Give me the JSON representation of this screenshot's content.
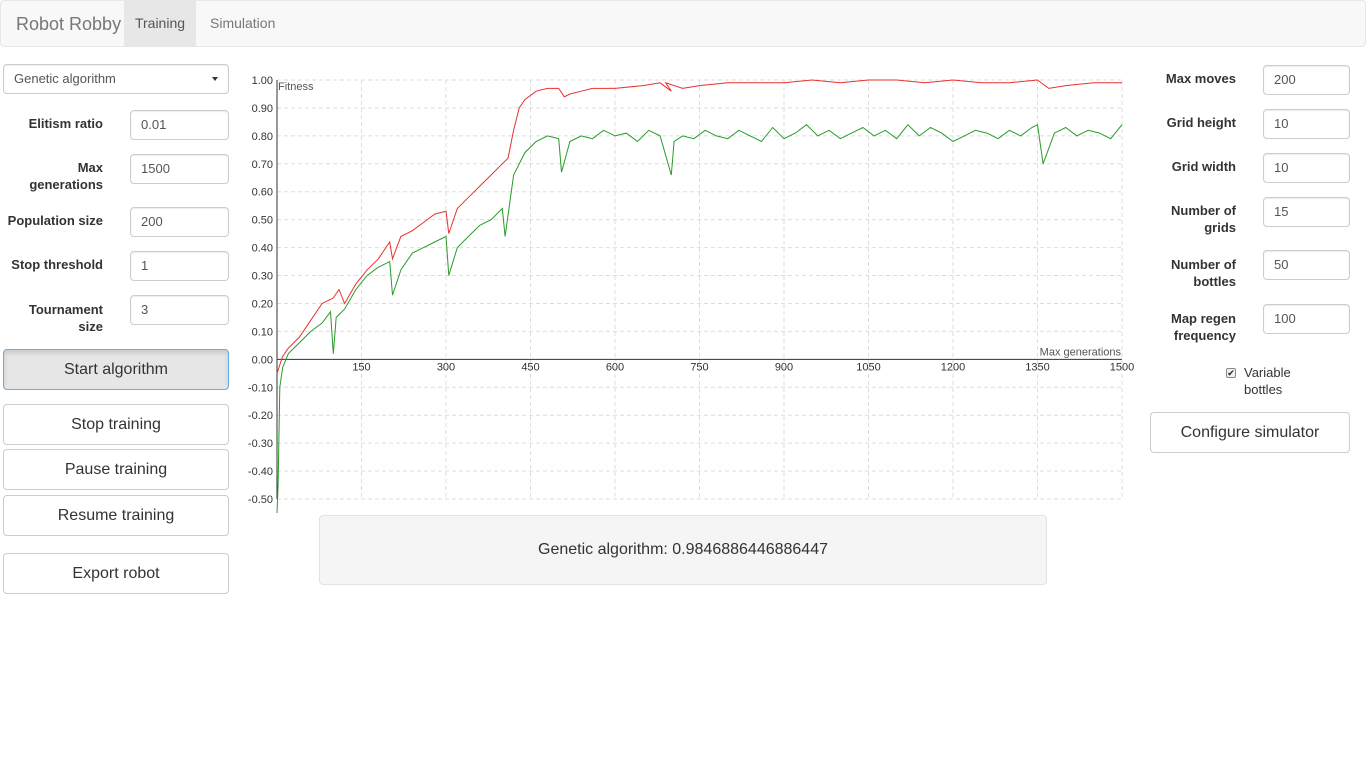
{
  "app": {
    "title": "Robot Robby"
  },
  "nav": {
    "tabs": [
      {
        "label": "Training",
        "active": true
      },
      {
        "label": "Simulation",
        "active": false
      }
    ]
  },
  "left_panel": {
    "algorithm_select": {
      "value": "Genetic algorithm"
    },
    "fields": [
      {
        "label": "Elitism ratio",
        "value": "0.01"
      },
      {
        "label": "Max generations",
        "value": "1500"
      },
      {
        "label": "Population size",
        "value": "200"
      },
      {
        "label": "Stop threshold",
        "value": "1"
      },
      {
        "label": "Tournament size",
        "value": "3"
      }
    ],
    "buttons": {
      "start": "Start algorithm",
      "stop": "Stop training",
      "pause": "Pause training",
      "resume": "Resume training",
      "export": "Export robot"
    }
  },
  "right_panel": {
    "fields": [
      {
        "label": "Max moves",
        "value": "200"
      },
      {
        "label": "Grid height",
        "value": "10"
      },
      {
        "label": "Grid width",
        "value": "10"
      },
      {
        "label": "Number of grids",
        "value": "15"
      },
      {
        "label": "Number of bottles",
        "value": "50"
      },
      {
        "label": "Map regen frequency",
        "value": "100"
      }
    ],
    "variable_bottles": {
      "label": "Variable bottles",
      "checked": true,
      "check_glyph": "✔"
    },
    "configure_button": "Configure simulator"
  },
  "result": {
    "text": "Genetic algorithm: 0.9846886446886447"
  },
  "colors": {
    "best_series": "#e8312f",
    "average_series": "#2a9a2a",
    "grid": "#dddddd"
  },
  "chart_data": {
    "type": "line",
    "ylabel": "Fitness",
    "xlabel": "Max generations",
    "xlim": [
      0,
      1500
    ],
    "ylim": [
      -0.5,
      1.0
    ],
    "x_ticks": [
      "150",
      "300",
      "450",
      "600",
      "750",
      "900",
      "1050",
      "1200",
      "1350",
      "1500"
    ],
    "y_ticks": [
      "1.00",
      "0.90",
      "0.80",
      "0.70",
      "0.60",
      "0.50",
      "0.40",
      "0.30",
      "0.20",
      "0.10",
      "0.00",
      "-0.10",
      "-0.20",
      "-0.30",
      "-0.40",
      "-0.50"
    ],
    "grid": true,
    "series": [
      {
        "color": "#e8312f",
        "x": [
          0,
          10,
          20,
          40,
          60,
          80,
          100,
          110,
          120,
          140,
          160,
          180,
          190,
          200,
          205,
          220,
          240,
          260,
          280,
          300,
          305,
          320,
          340,
          360,
          380,
          400,
          410,
          420,
          430,
          440,
          460,
          480,
          500,
          510,
          520,
          540,
          560,
          600,
          650,
          680,
          700,
          690,
          720,
          750,
          800,
          900,
          950,
          1000,
          1050,
          1100,
          1150,
          1200,
          1250,
          1300,
          1350,
          1370,
          1400,
          1450,
          1500
        ],
        "y": [
          -0.05,
          0.01,
          0.04,
          0.08,
          0.14,
          0.2,
          0.22,
          0.25,
          0.2,
          0.27,
          0.32,
          0.36,
          0.39,
          0.42,
          0.36,
          0.44,
          0.46,
          0.49,
          0.52,
          0.53,
          0.45,
          0.54,
          0.58,
          0.62,
          0.66,
          0.7,
          0.72,
          0.82,
          0.9,
          0.93,
          0.96,
          0.97,
          0.97,
          0.94,
          0.95,
          0.96,
          0.97,
          0.97,
          0.98,
          0.99,
          0.96,
          0.99,
          0.97,
          0.98,
          0.99,
          0.99,
          1.0,
          0.99,
          1.0,
          1.0,
          0.99,
          1.0,
          0.99,
          0.99,
          1.0,
          0.97,
          0.98,
          0.99,
          0.99
        ]
      },
      {
        "color": "#2a9a2a",
        "x": [
          0,
          2,
          5,
          10,
          20,
          40,
          60,
          80,
          95,
          100,
          105,
          120,
          140,
          160,
          180,
          200,
          205,
          220,
          240,
          260,
          280,
          300,
          305,
          320,
          340,
          360,
          380,
          400,
          405,
          420,
          440,
          460,
          480,
          500,
          505,
          520,
          540,
          560,
          580,
          600,
          620,
          640,
          660,
          680,
          700,
          705,
          720,
          740,
          760,
          780,
          800,
          820,
          840,
          860,
          880,
          900,
          920,
          940,
          960,
          980,
          1000,
          1020,
          1040,
          1060,
          1080,
          1100,
          1120,
          1140,
          1160,
          1180,
          1200,
          1220,
          1240,
          1260,
          1280,
          1300,
          1320,
          1340,
          1350,
          1360,
          1380,
          1400,
          1420,
          1440,
          1460,
          1480,
          1500
        ],
        "y": [
          -0.55,
          -0.45,
          -0.1,
          -0.03,
          0.02,
          0.06,
          0.1,
          0.13,
          0.17,
          0.02,
          0.15,
          0.18,
          0.25,
          0.3,
          0.33,
          0.35,
          0.23,
          0.32,
          0.38,
          0.4,
          0.42,
          0.44,
          0.3,
          0.4,
          0.44,
          0.48,
          0.5,
          0.54,
          0.44,
          0.66,
          0.74,
          0.78,
          0.8,
          0.79,
          0.67,
          0.78,
          0.8,
          0.79,
          0.82,
          0.8,
          0.81,
          0.78,
          0.82,
          0.8,
          0.66,
          0.78,
          0.8,
          0.79,
          0.82,
          0.8,
          0.79,
          0.82,
          0.8,
          0.78,
          0.83,
          0.79,
          0.81,
          0.84,
          0.8,
          0.82,
          0.79,
          0.81,
          0.83,
          0.8,
          0.82,
          0.79,
          0.84,
          0.8,
          0.83,
          0.81,
          0.78,
          0.8,
          0.82,
          0.81,
          0.79,
          0.82,
          0.8,
          0.83,
          0.84,
          0.7,
          0.81,
          0.83,
          0.8,
          0.82,
          0.81,
          0.79,
          0.84
        ]
      }
    ]
  }
}
